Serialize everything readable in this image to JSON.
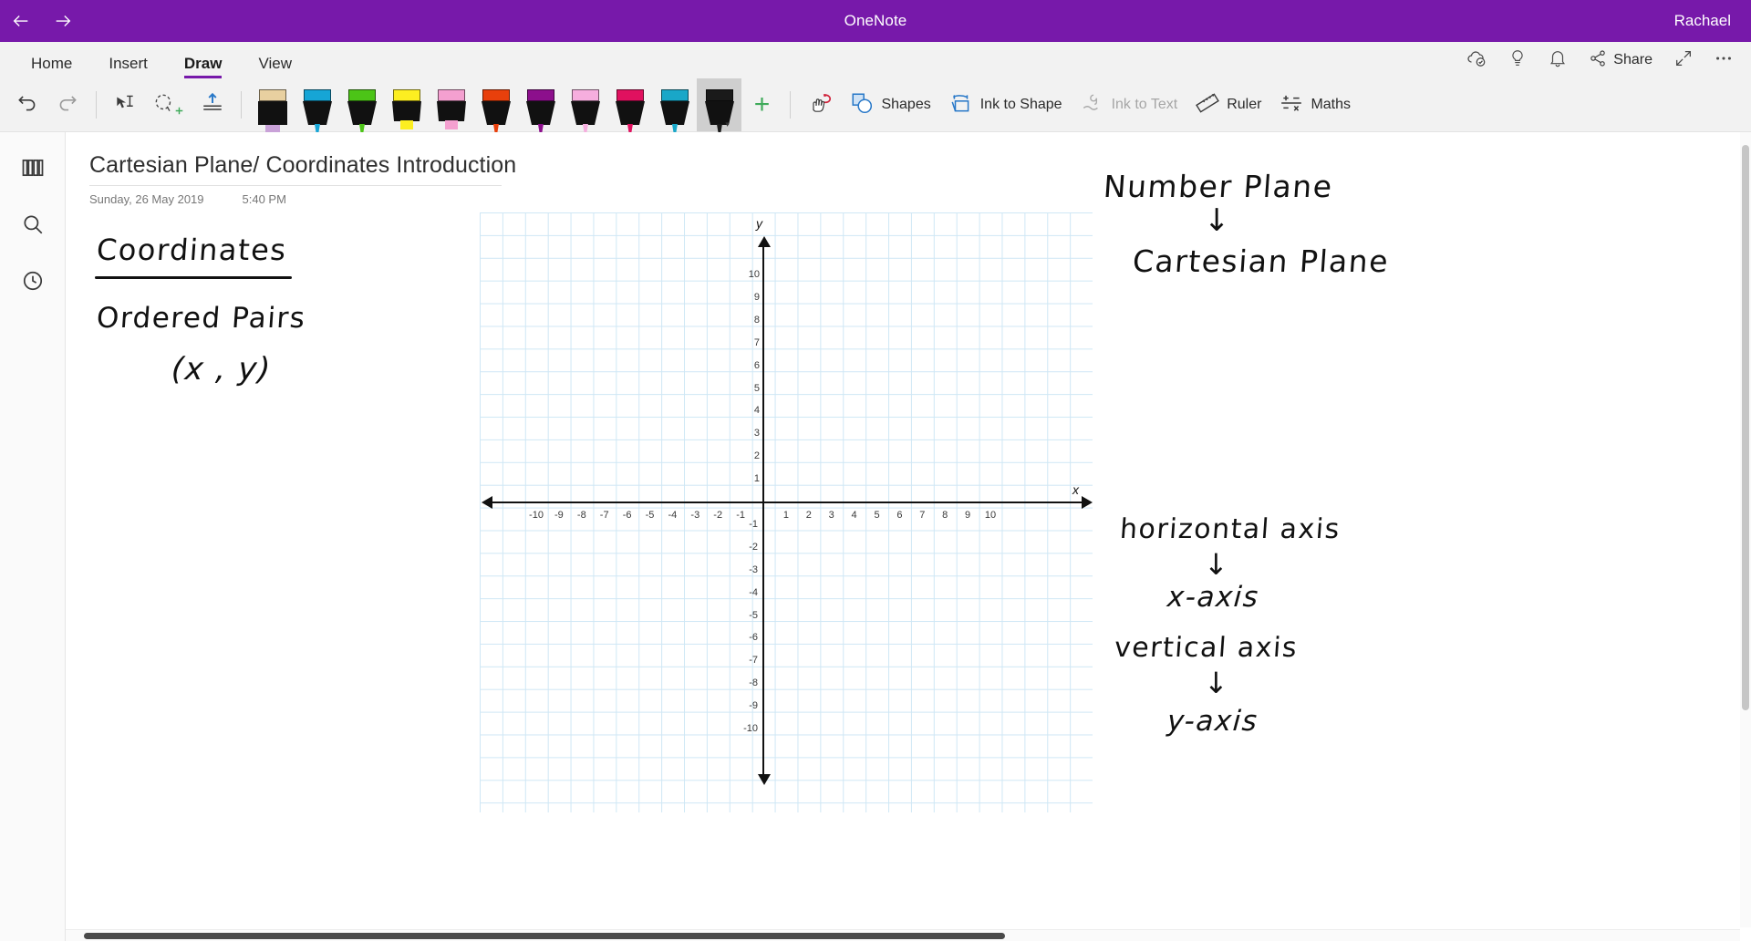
{
  "titlebar": {
    "back_icon": "arrow-left-icon",
    "forward_icon": "arrow-right-icon",
    "app_title": "OneNote",
    "user": "Rachael",
    "background": "#7719aa"
  },
  "ribbon": {
    "tabs": [
      {
        "label": "Home",
        "active": false
      },
      {
        "label": "Insert",
        "active": false
      },
      {
        "label": "Draw",
        "active": true
      },
      {
        "label": "View",
        "active": false
      }
    ],
    "accent": "#7719aa",
    "quick_actions": [
      {
        "name": "sync-status-icon",
        "label": ""
      },
      {
        "name": "lightbulb-icon",
        "label": ""
      },
      {
        "name": "bell-icon",
        "label": ""
      },
      {
        "name": "share-icon",
        "label": "Share"
      },
      {
        "name": "expand-icon",
        "label": ""
      },
      {
        "name": "more-options-icon",
        "label": ""
      }
    ]
  },
  "toolbar": {
    "undo_label": "Undo",
    "redo_label": "Redo",
    "select_label": "Lasso Select",
    "ink_select_label": "Ink Select",
    "insert_space_label": "Insert Space",
    "add_pen_label": "+",
    "eraser_label": "Eraser",
    "shapes_label": "Shapes",
    "ink_to_shape_label": "Ink to Shape",
    "ink_to_text_label": "Ink to Text",
    "ink_to_text_disabled": true,
    "ruler_label": "Ruler",
    "maths_label": "Maths",
    "pens": [
      {
        "name": "pen-cream-highlighter",
        "color": "#e8d0a0",
        "type": "highlighter",
        "selected": false
      },
      {
        "name": "pen-cyan",
        "color": "#16a5d6",
        "type": "pen",
        "selected": false
      },
      {
        "name": "pen-green",
        "color": "#4cc417",
        "type": "pen",
        "selected": false
      },
      {
        "name": "pen-yellow-highlighter",
        "color": "#fcee21",
        "type": "highlighter",
        "selected": false
      },
      {
        "name": "pen-pink-highlighter",
        "color": "#f4a0d0",
        "type": "highlighter",
        "selected": false
      },
      {
        "name": "pen-orange",
        "color": "#e8400c",
        "type": "pen",
        "selected": false
      },
      {
        "name": "pen-purple",
        "color": "#8c0f8c",
        "type": "pen",
        "selected": false
      },
      {
        "name": "pen-light-pink",
        "color": "#f6aede",
        "type": "pen",
        "selected": false
      },
      {
        "name": "pen-crimson",
        "color": "#e0115f",
        "type": "pen",
        "selected": false
      },
      {
        "name": "pen-teal",
        "color": "#19a7c8",
        "type": "pen",
        "selected": false
      },
      {
        "name": "pen-black-selected",
        "color": "#1a1a1a",
        "type": "pen",
        "selected": true
      }
    ]
  },
  "rail": {
    "items": [
      {
        "name": "notebooks-icon",
        "label": "Notebooks"
      },
      {
        "name": "search-icon",
        "label": "Search"
      },
      {
        "name": "recent-notes-icon",
        "label": "Recent Notes"
      }
    ]
  },
  "page": {
    "title": "Cartesian Plane/ Coordinates Introduction",
    "date": "Sunday, 26 May 2019",
    "time": "5:40 PM"
  },
  "notes": {
    "left": [
      {
        "text": "Coordinates",
        "underlined": true
      },
      {
        "text": "Ordered Pairs"
      },
      {
        "text": "(x , y)"
      }
    ],
    "right": [
      {
        "text": "Number Plane"
      },
      {
        "text": "↓"
      },
      {
        "text": "Cartesian Plane"
      },
      {
        "text": "horizontal axis"
      },
      {
        "text": "↓"
      },
      {
        "text": "x-axis"
      },
      {
        "text": "vertical axis"
      },
      {
        "text": "↓"
      },
      {
        "text": "y-axis"
      }
    ]
  },
  "chart_data": {
    "type": "scatter",
    "title": "",
    "xlabel": "x",
    "ylabel": "y",
    "xlim": [
      -11,
      11
    ],
    "ylim": [
      -11,
      11
    ],
    "grid": true,
    "legend": "none",
    "x_ticks": [
      -10,
      -9,
      -8,
      -7,
      -6,
      -5,
      -4,
      -3,
      -2,
      -1,
      1,
      2,
      3,
      4,
      5,
      6,
      7,
      8,
      9,
      10
    ],
    "y_ticks": [
      10,
      9,
      8,
      7,
      6,
      5,
      4,
      3,
      2,
      1,
      -1,
      -2,
      -3,
      -4,
      -5,
      -6,
      -7,
      -8,
      -9,
      -10
    ],
    "x_tick_labels": [
      "-10",
      "-9",
      "-8",
      "-7",
      "-6",
      "-5",
      "-4",
      "-3",
      "-2",
      "-1",
      "1",
      "2",
      "3",
      "4",
      "5",
      "6",
      "7",
      "8",
      "9",
      "10"
    ],
    "y_tick_labels": [
      "10",
      "9",
      "8",
      "7",
      "6",
      "5",
      "4",
      "3",
      "2",
      "1",
      "-1",
      "-2",
      "-3",
      "-4",
      "-5",
      "-6",
      "-7",
      "-8",
      "-9",
      "-10"
    ],
    "series": [],
    "axis_arrows": [
      "left",
      "right",
      "up",
      "down"
    ],
    "grid_color": "#cfe7f5",
    "axis_color": "#111111"
  }
}
